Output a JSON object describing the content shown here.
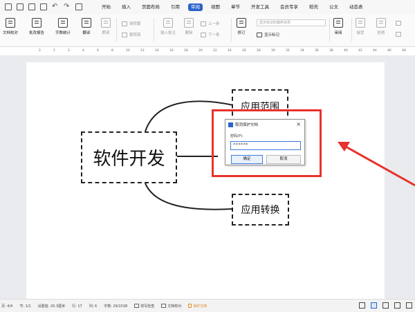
{
  "menubar": {
    "tabs": [
      "开始",
      "插入",
      "页面布局",
      "引用",
      "审阅",
      "视图",
      "章节",
      "开发工具",
      "会员专享",
      "稻壳",
      "公文",
      "动态表"
    ],
    "active_tab": "审阅"
  },
  "ribbon": {
    "doc_compare": "文档校对",
    "batch_report": "批改报告",
    "word_count": "字数统计",
    "translate": "翻译",
    "read_aloud": "朗读",
    "simp_trad": "简转繁",
    "trad_simp": "繁转简",
    "insert_comment": "插入批注",
    "delete": "删除",
    "prev": "上一条",
    "next": "下一条",
    "revise": "修订",
    "show_markup": "显示标记",
    "markup_combo": "显示标记的最终状态",
    "review": "审阅",
    "accept": "接受",
    "reject": "拒绝",
    "prev_change": "上一条",
    "next_change": "下一条",
    "compare": "比较",
    "restrict_edit": "限制编辑"
  },
  "ruler": {
    "ticks": [
      "2",
      "1",
      "2",
      "4",
      "6",
      "8",
      "10",
      "12",
      "14",
      "16",
      "18",
      "20",
      "22",
      "24",
      "26",
      "28",
      "30",
      "32",
      "34",
      "36",
      "38",
      "40",
      "42",
      "44",
      "46",
      "48"
    ]
  },
  "diagram": {
    "main_node": "软件开发",
    "top_node": "应用范围",
    "bottom_node": "应用转换"
  },
  "dialog": {
    "title": "取消保护文档",
    "label": "密码(P):",
    "password_value": "******",
    "ok": "确定",
    "cancel": "取消"
  },
  "statusbar": {
    "page": "页: 4/4",
    "section": "节: 1/1",
    "position": "设置值: 20.3厘米",
    "row": "行: 17",
    "col": "列: 6",
    "words": "字数: 29/1538",
    "spell": "拼写检查",
    "doc_check": "文档校对",
    "protect": "保护文档"
  },
  "colors": {
    "accent": "#2b63c9",
    "highlight": "#e8322c"
  }
}
